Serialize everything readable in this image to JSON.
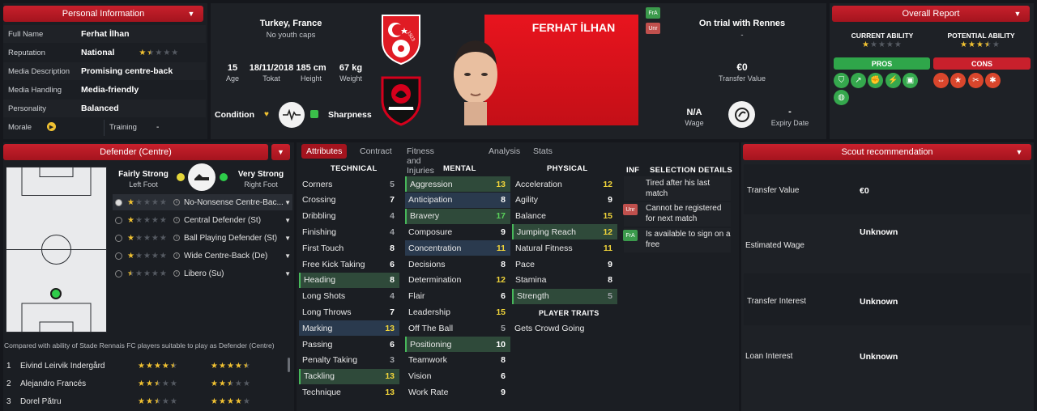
{
  "personal": {
    "header": "Personal Information",
    "rows": [
      {
        "label": "Full Name",
        "value": "Ferhat İlhan"
      },
      {
        "label": "Reputation",
        "value": "National"
      },
      {
        "label": "Media Description",
        "value": "Promising centre-back"
      },
      {
        "label": "Media Handling",
        "value": "Media-friendly"
      },
      {
        "label": "Personality",
        "value": "Balanced"
      }
    ],
    "reputation_stars": 1.5,
    "morale_label": "Morale",
    "training_label": "Training",
    "training_value": "-"
  },
  "player": {
    "nationality": "Turkey, France",
    "youth_caps": "No youth caps",
    "age": "15",
    "age_label": "Age",
    "dob": "18/11/2018",
    "dob_label": "Tokat",
    "height": "185 cm",
    "height_label": "Height",
    "weight": "67 kg",
    "weight_label": "Weight",
    "condition_label": "Condition",
    "sharpness_label": "Sharpness",
    "name": "FERHAT İLHAN",
    "badge_fra": "FrA",
    "badge_unr": "Unr",
    "status": "On trial with Rennes",
    "status_sub": "-",
    "transfer_value": "€0",
    "transfer_value_label": "Transfer Value",
    "wage": "N/A",
    "wage_label": "Wage",
    "expiry": "-",
    "expiry_label": "Expiry Date",
    "club_badge_text": "STADE RENNAIS",
    "flag_year": "1923"
  },
  "overall": {
    "header": "Overall Report",
    "current_label": "CURRENT ABILITY",
    "potential_label": "POTENTIAL ABILITY",
    "current_stars": 1,
    "potential_stars": 3.5,
    "pros_label": "PROS",
    "cons_label": "CONS"
  },
  "position": {
    "header": "Defender (Centre)",
    "weak_foot_label": "Fairly Strong",
    "weak_foot_sub": "Left Foot",
    "strong_foot_label": "Very Strong",
    "strong_foot_sub": "Right Foot",
    "roles": [
      {
        "name": "No-Nonsense Centre-Bac...",
        "stars": 1
      },
      {
        "name": "Central Defender (St)",
        "stars": 1
      },
      {
        "name": "Ball Playing Defender (St)",
        "stars": 1
      },
      {
        "name": "Wide Centre-Back (De)",
        "stars": 1
      },
      {
        "name": "Libero (Su)",
        "stars": 0.5
      }
    ],
    "compare_text": "Compared with ability of Stade Rennais FC players suitable to play as Defender (Centre)",
    "compare": [
      {
        "rank": "1",
        "name": "Eivind Leirvik Indergård",
        "ca": 4.5,
        "pa": 4.5
      },
      {
        "rank": "2",
        "name": "Alejandro Francés",
        "ca": 2.5,
        "pa": 2.5
      },
      {
        "rank": "3",
        "name": "Dorel Pătru",
        "ca": 2.5,
        "pa": 4
      }
    ]
  },
  "tabs": [
    "Attributes",
    "Contract",
    "Fitness and Injuries",
    "Analysis",
    "Stats"
  ],
  "attributes": {
    "technical_label": "TECHNICAL",
    "mental_label": "MENTAL",
    "physical_label": "PHYSICAL",
    "traits_label": "PLAYER TRAITS",
    "traits": [
      "Gets Crowd Going"
    ],
    "technical": [
      {
        "name": "Corners",
        "value": "5",
        "hl": ""
      },
      {
        "name": "Crossing",
        "value": "7",
        "hl": ""
      },
      {
        "name": "Dribbling",
        "value": "4",
        "hl": ""
      },
      {
        "name": "Finishing",
        "value": "4",
        "hl": ""
      },
      {
        "name": "First Touch",
        "value": "8",
        "hl": ""
      },
      {
        "name": "Free Kick Taking",
        "value": "6",
        "hl": ""
      },
      {
        "name": "Heading",
        "value": "8",
        "hl": "green"
      },
      {
        "name": "Long Shots",
        "value": "4",
        "hl": ""
      },
      {
        "name": "Long Throws",
        "value": "7",
        "hl": ""
      },
      {
        "name": "Marking",
        "value": "13",
        "hl": "blue"
      },
      {
        "name": "Passing",
        "value": "6",
        "hl": ""
      },
      {
        "name": "Penalty Taking",
        "value": "3",
        "hl": ""
      },
      {
        "name": "Tackling",
        "value": "13",
        "hl": "green"
      },
      {
        "name": "Technique",
        "value": "13",
        "hl": ""
      }
    ],
    "mental": [
      {
        "name": "Aggression",
        "value": "13",
        "hl": "green"
      },
      {
        "name": "Anticipation",
        "value": "8",
        "hl": "blue"
      },
      {
        "name": "Bravery",
        "value": "17",
        "hl": "green"
      },
      {
        "name": "Composure",
        "value": "9",
        "hl": ""
      },
      {
        "name": "Concentration",
        "value": "11",
        "hl": "blue"
      },
      {
        "name": "Decisions",
        "value": "8",
        "hl": ""
      },
      {
        "name": "Determination",
        "value": "12",
        "hl": ""
      },
      {
        "name": "Flair",
        "value": "6",
        "hl": ""
      },
      {
        "name": "Leadership",
        "value": "15",
        "hl": ""
      },
      {
        "name": "Off The Ball",
        "value": "5",
        "hl": ""
      },
      {
        "name": "Positioning",
        "value": "10",
        "hl": "green"
      },
      {
        "name": "Teamwork",
        "value": "8",
        "hl": ""
      },
      {
        "name": "Vision",
        "value": "6",
        "hl": ""
      },
      {
        "name": "Work Rate",
        "value": "9",
        "hl": ""
      }
    ],
    "physical": [
      {
        "name": "Acceleration",
        "value": "12",
        "hl": ""
      },
      {
        "name": "Agility",
        "value": "9",
        "hl": ""
      },
      {
        "name": "Balance",
        "value": "15",
        "hl": ""
      },
      {
        "name": "Jumping Reach",
        "value": "12",
        "hl": "green"
      },
      {
        "name": "Natural Fitness",
        "value": "11",
        "hl": ""
      },
      {
        "name": "Pace",
        "value": "9",
        "hl": ""
      },
      {
        "name": "Stamina",
        "value": "8",
        "hl": ""
      },
      {
        "name": "Strength",
        "value": "5",
        "hl": "green"
      }
    ]
  },
  "selection": {
    "inf_label": "INF",
    "header": "SELECTION DETAILS",
    "items": [
      {
        "badge": "",
        "text": "Tired after his last match"
      },
      {
        "badge": "Unr",
        "text": "Cannot be registered for next match"
      },
      {
        "badge": "FrA",
        "text": "Is available to sign on a free"
      }
    ]
  },
  "scout": {
    "header": "Scout recommendation",
    "rows": [
      {
        "label": "Transfer Value",
        "value": "€0"
      },
      {
        "label": "Estimated Wage",
        "value": "Unknown"
      },
      {
        "label": "Transfer Interest",
        "value": "Unknown"
      },
      {
        "label": "Loan Interest",
        "value": "Unknown"
      }
    ]
  },
  "colors": {
    "accent_red": "#c8202c",
    "highlight_green": "#2f4a3a",
    "highlight_blue": "#2a3a4e",
    "value_yellow": "#f0d43a",
    "value_green": "#59d05a"
  }
}
